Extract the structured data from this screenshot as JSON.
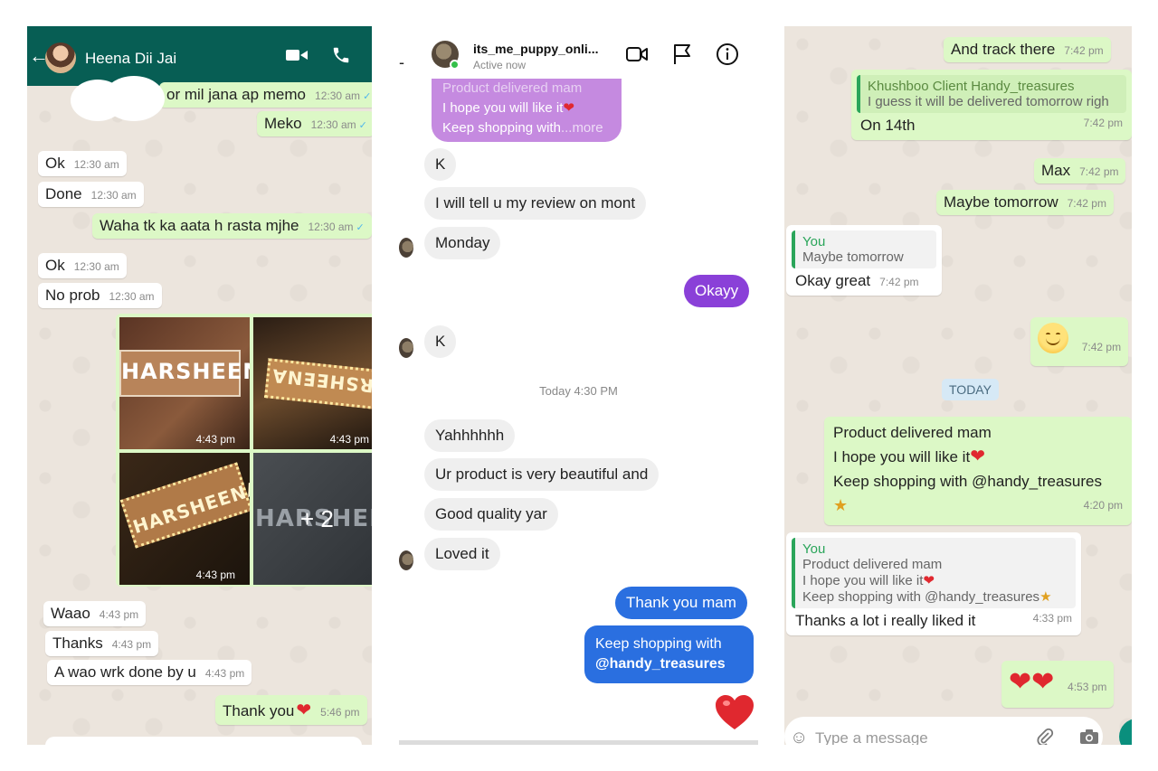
{
  "whatsapp_chat_1": {
    "contact_name": "Heena Dii Jai",
    "messages": [
      {
        "dir": "out",
        "text": "or mil jana ap memo",
        "time": "12:30 am"
      },
      {
        "dir": "out",
        "text": "Meko",
        "time": "12:30 am"
      },
      {
        "dir": "in",
        "text": "Ok",
        "time": "12:30 am"
      },
      {
        "dir": "in",
        "text": "Done",
        "time": "12:30 am"
      },
      {
        "dir": "out",
        "text": "Waha tk ka aata h rasta mjhe",
        "time": "12:30 am"
      },
      {
        "dir": "in",
        "text": "Ok",
        "time": "12:30 am"
      },
      {
        "dir": "in",
        "text": "No prob",
        "time": "12:30 am"
      },
      {
        "dir": "in",
        "text": "Waao",
        "time": "4:43 pm"
      },
      {
        "dir": "in",
        "text": "Thanks",
        "time": "4:43 pm"
      },
      {
        "dir": "in",
        "text": "A wao wrk done by u",
        "time": "4:43 pm"
      },
      {
        "dir": "out",
        "text": "Thank you",
        "time": "5:46 pm"
      }
    ],
    "gallery": {
      "photo_time": "4:43 pm",
      "sign_text_1": "HARSHEENA",
      "sign_text_2": "HARSHEENA",
      "sign_text_3": "HARSHEENA",
      "sign_text_4": "HARSHEENA",
      "more_count": "+ 2"
    }
  },
  "instagram_chat": {
    "username": "its_me_puppy_onli...",
    "status": "Active now",
    "quoted_lines": [
      "Product delivered mam",
      "I hope you will like it",
      "Keep shopping with",
      "...more"
    ],
    "messages": [
      {
        "dir": "in",
        "text": "K"
      },
      {
        "dir": "in",
        "text": "I will tell u my review on mont"
      },
      {
        "dir": "in",
        "text": "Monday"
      },
      {
        "dir": "out",
        "text": "Okayy"
      },
      {
        "dir": "in",
        "text": "K"
      },
      {
        "dir": "in",
        "text": "Yahhhhhh"
      },
      {
        "dir": "in",
        "text": "Ur product is very beautiful and"
      },
      {
        "dir": "in",
        "text": "Good  quality yar"
      },
      {
        "dir": "in",
        "text": "Loved it"
      },
      {
        "dir": "out",
        "text": "Thank you mam"
      },
      {
        "dir": "out",
        "text": "Keep shopping with"
      },
      {
        "dir": "out",
        "text": "@handy_treasures"
      }
    ],
    "separator": "Today 4:30 PM"
  },
  "whatsapp_chat_2": {
    "messages": [
      {
        "text": "And track there",
        "time": "7:42 pm"
      },
      {
        "text": "On 14th",
        "time": "7:42 pm"
      },
      {
        "text": "Max",
        "time": "7:42 pm"
      },
      {
        "text": "Maybe tomorrow",
        "time": "7:42 pm"
      },
      {
        "text": "Okay great",
        "time": "7:42 pm"
      },
      {
        "text": "",
        "time": "7:42 pm"
      },
      {
        "text": "Product delivered mam",
        "time": ""
      },
      {
        "text": "I hope you will like it",
        "time": ""
      },
      {
        "text": "Keep shopping with @handy_treasures",
        "time": "4:20 pm"
      },
      {
        "text": "Thanks a lot i really liked it",
        "time": "4:33 pm"
      },
      {
        "text": "",
        "time": "4:53 pm"
      }
    ],
    "quote_1": {
      "name": "Khushboo Client Handy_treasures",
      "text": "I guess it will be delivered tomorrow righ"
    },
    "quote_2": {
      "name": "You",
      "text": "Maybe tomorrow"
    },
    "quote_3": {
      "name": "You",
      "lines": [
        "Product delivered mam",
        "I hope you will like it",
        "Keep shopping with @handy_treasures"
      ]
    },
    "date_chip": "TODAY",
    "input_placeholder": "Type a message"
  },
  "colors": {
    "wa_header": "#075e54",
    "wa_out_bubble": "#dcf8c6",
    "ig_purple": "#8a40d8",
    "ig_blue": "#2a6fe0",
    "heart": "#e0282f"
  }
}
